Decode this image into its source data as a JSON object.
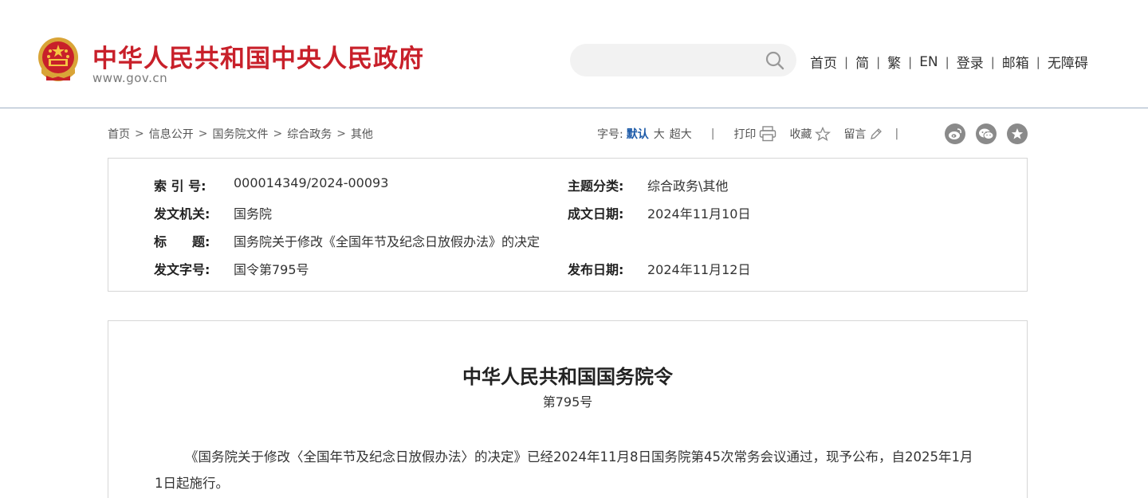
{
  "header": {
    "site_title": "中华人民共和国中央人民政府",
    "site_url": "www.gov.cn",
    "search_placeholder": "",
    "nav": [
      "首页",
      "简",
      "繁",
      "EN",
      "登录",
      "邮箱",
      "无障碍"
    ],
    "nav_separator": "|"
  },
  "breadcrumb": {
    "items": [
      "首页",
      "信息公开",
      "国务院文件",
      "综合政务",
      "其他"
    ],
    "separator": ">"
  },
  "toolbar": {
    "font_size_label": "字号:",
    "font_sizes": [
      "默认",
      "大",
      "超大"
    ],
    "divider": "|",
    "print_label": "打印",
    "favorite_label": "收藏",
    "comment_label": "留言"
  },
  "share_icons": [
    "weibo-icon",
    "wechat-icon",
    "star-share-icon"
  ],
  "info": {
    "index_label": "索 引 号:",
    "index_value": "000014349/2024-00093",
    "topic_label": "主题分类:",
    "topic_value": "综合政务\\其他",
    "issuer_label": "发文机关:",
    "issuer_value": "国务院",
    "written_date_label": "成文日期:",
    "written_date_value": "2024年11月10日",
    "title_label": "标　　题:",
    "title_value": "国务院关于修改《全国年节及纪念日放假办法》的决定",
    "doc_number_label": "发文字号:",
    "doc_number_value": "国令第795号",
    "publish_date_label": "发布日期:",
    "publish_date_value": "2024年11月12日"
  },
  "article": {
    "title": "中华人民共和国国务院令",
    "number": "第795号",
    "paragraph": "《国务院关于修改〈全国年节及纪念日放假办法〉的决定》已经2024年11月8日国务院第45次常务会议通过，现予公布，自2025年1月1日起施行。"
  },
  "colors": {
    "brand_red": "#c8202a",
    "link_blue": "#1c5aa8",
    "header_border": "#9fb0c4",
    "box_border": "#d6d6d6",
    "share_gray": "#8a8a8a"
  }
}
